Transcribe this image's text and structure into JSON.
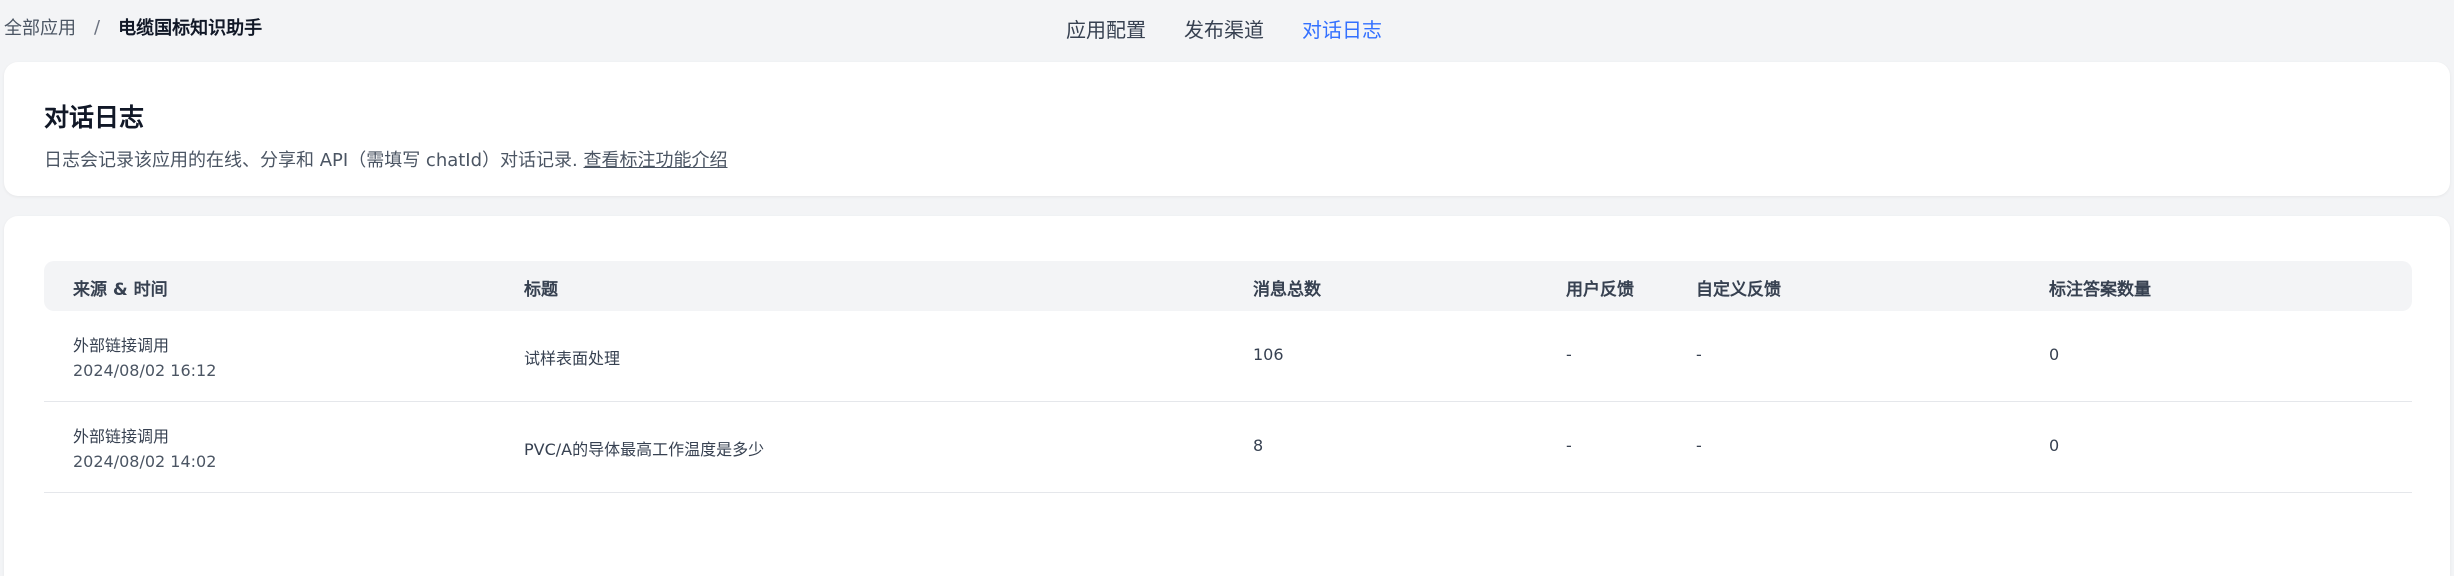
{
  "breadcrumb": {
    "root": "全部应用",
    "separator": "/",
    "current": "电缆国标知识助手"
  },
  "nav": {
    "tabs": [
      {
        "label": "应用配置"
      },
      {
        "label": "发布渠道"
      },
      {
        "label": "对话日志"
      }
    ],
    "active_tab": "对话日志"
  },
  "intro": {
    "title": "对话日志",
    "description": "日志会记录该应用的在线、分享和 API（需填写 chatId）对话记录.",
    "link_text": "查看标注功能介绍"
  },
  "table": {
    "headers": [
      "来源 & 时间",
      "标题",
      "消息总数",
      "用户反馈",
      "自定义反馈",
      "标注答案数量"
    ],
    "rows": [
      {
        "source": "外部链接调用",
        "time": "2024/08/02 16:12",
        "title": "试样表面处理",
        "messages": "106",
        "user_feedback": "-",
        "custom_feedback": "-",
        "annotations": "0"
      },
      {
        "source": "外部链接调用",
        "time": "2024/08/02 14:02",
        "title": "PVC/A的导体最高工作温度是多少",
        "messages": "8",
        "user_feedback": "-",
        "custom_feedback": "-",
        "annotations": "0"
      }
    ]
  },
  "colors": {
    "accent": "#3370ff",
    "background": "#f3f4f6",
    "card": "#ffffff"
  }
}
